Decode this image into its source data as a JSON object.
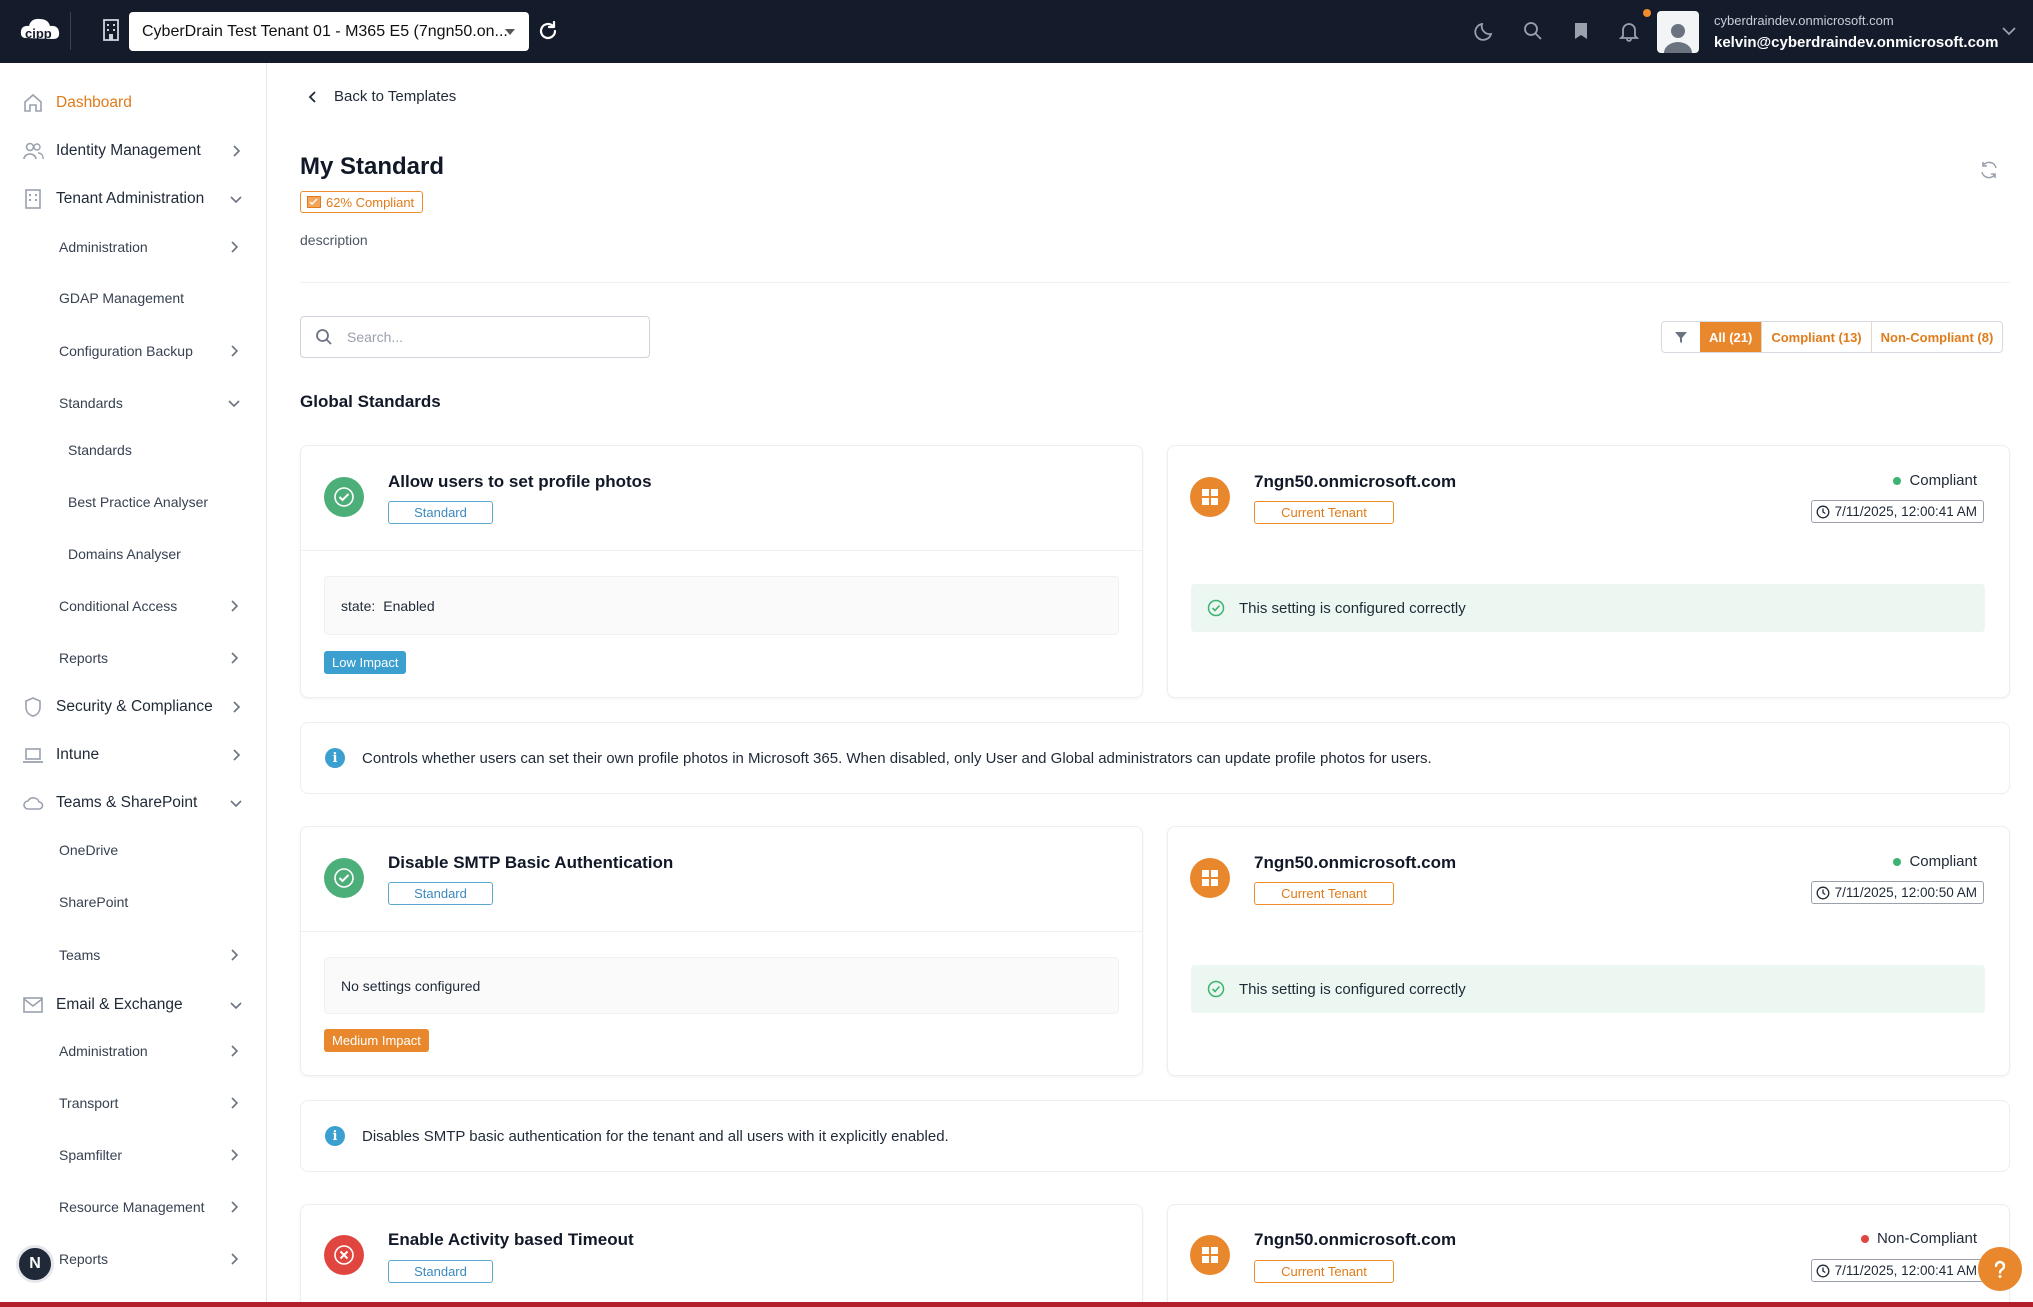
{
  "topbar": {
    "tenant": "CyberDrain Test Tenant 01 - M365 E5 (7ngn50.on...",
    "user_domain": "cyberdraindev.onmicrosoft.com",
    "user_email": "kelvin@cyberdraindev.onmicrosoft.com",
    "icons": [
      "moon-icon",
      "search-icon",
      "bookmark-icon",
      "bell-icon"
    ]
  },
  "sidebar": {
    "items": [
      {
        "label": "Dashboard"
      },
      {
        "label": "Identity Management"
      },
      {
        "label": "Tenant Administration"
      },
      {
        "label": "Administration"
      },
      {
        "label": "GDAP Management"
      },
      {
        "label": "Configuration Backup"
      },
      {
        "label": "Standards"
      },
      {
        "label": "Standards"
      },
      {
        "label": "Best Practice Analyser"
      },
      {
        "label": "Domains Analyser"
      },
      {
        "label": "Conditional Access"
      },
      {
        "label": "Reports"
      },
      {
        "label": "Security & Compliance"
      },
      {
        "label": "Intune"
      },
      {
        "label": "Teams & SharePoint"
      },
      {
        "label": "OneDrive"
      },
      {
        "label": "SharePoint"
      },
      {
        "label": "Teams"
      },
      {
        "label": "Email & Exchange"
      },
      {
        "label": "Administration"
      },
      {
        "label": "Transport"
      },
      {
        "label": "Spamfilter"
      },
      {
        "label": "Resource Management"
      },
      {
        "label": "Reports"
      }
    ],
    "user_initial": "N"
  },
  "main": {
    "back_label": "Back to Templates",
    "title": "My Standard",
    "compliance": "62% Compliant",
    "description": "description",
    "search_placeholder": "Search...",
    "filters": {
      "all": "All (21)",
      "compliant": "Compliant (13)",
      "noncompliant": "Non-Compliant (8)"
    },
    "section_title": "Global Standards",
    "standards": [
      {
        "name": "Allow users to set profile photos",
        "tag": "Standard",
        "setting_key": "state:",
        "setting_value": "Enabled",
        "impact": "Low Impact",
        "tenant": "7ngn50.onmicrosoft.com",
        "tenant_tag": "Current Tenant",
        "status": "Compliant",
        "timestamp": "7/11/2025, 12:00:41 AM",
        "result": "This setting is configured correctly",
        "info": "Controls whether users can set their own profile photos in Microsoft 365. When disabled, only User and Global administrators can update profile photos for users."
      },
      {
        "name": "Disable SMTP Basic Authentication",
        "tag": "Standard",
        "setting": "No settings configured",
        "impact": "Medium Impact",
        "tenant": "7ngn50.onmicrosoft.com",
        "tenant_tag": "Current Tenant",
        "status": "Compliant",
        "timestamp": "7/11/2025, 12:00:50 AM",
        "result": "This setting is configured correctly",
        "info": "Disables SMTP basic authentication for the tenant and all users with it explicitly enabled."
      },
      {
        "name": "Enable Activity based Timeout",
        "tag": "Standard",
        "tenant": "7ngn50.onmicrosoft.com",
        "tenant_tag": "Current Tenant",
        "status": "Non-Compliant",
        "timestamp": "7/11/2025, 12:00:41 AM"
      }
    ]
  },
  "colors": {
    "accent": "#e8872c",
    "topbar": "#141b2b",
    "compliant": "#4caf7a",
    "noncompliant": "#e0463f",
    "info": "#3b9fcf"
  }
}
